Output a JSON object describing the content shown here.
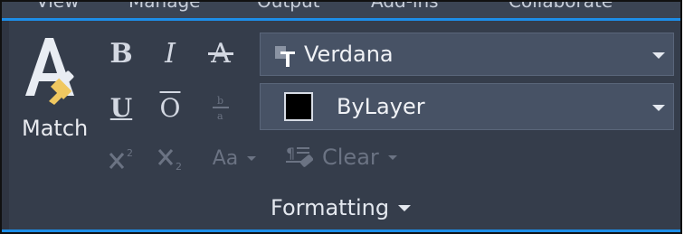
{
  "tabs": [
    "View",
    "Manage",
    "Output",
    "Add-ins",
    "Collaborate"
  ],
  "match": {
    "label": "Match"
  },
  "font_dropdown": {
    "value": "Verdana"
  },
  "color_dropdown": {
    "value": "ByLayer"
  },
  "clear": {
    "label": "Clear"
  },
  "panel": {
    "title": "Formatting"
  },
  "glyphs": {
    "bold": "B",
    "italic": "I",
    "strike": "A",
    "underline": "U",
    "overline": "O",
    "case": "Aa"
  },
  "colors": {
    "accent": "#1d8ee8",
    "panel_bg": "#353d4b",
    "dropdown_bg": "#475265",
    "text": "#e4e8ef",
    "disabled_text": "#6b7383"
  }
}
